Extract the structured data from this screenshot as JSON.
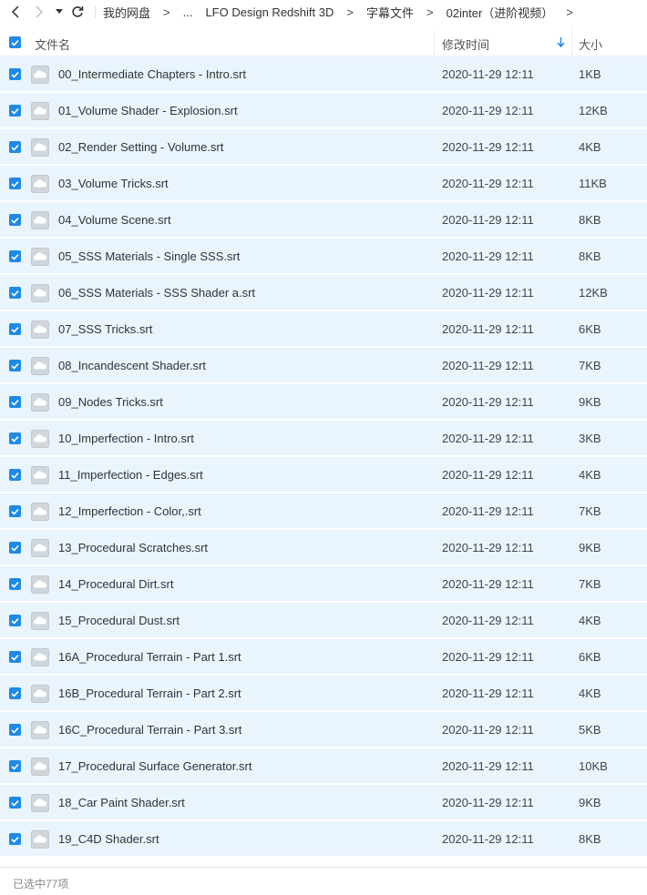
{
  "nav": {
    "breadcrumbs": [
      "我的网盘",
      "...",
      "LFO Design Redshift 3D",
      "字幕文件",
      "02inter（进阶视频）"
    ],
    "separator": ">"
  },
  "header": {
    "name": "文件名",
    "date": "修改时间",
    "size": "大小"
  },
  "files": [
    {
      "name": "00_Intermediate Chapters - Intro.srt",
      "date": "2020-11-29 12:11",
      "size": "1KB"
    },
    {
      "name": "01_Volume Shader - Explosion.srt",
      "date": "2020-11-29 12:11",
      "size": "12KB"
    },
    {
      "name": "02_Render Setting - Volume.srt",
      "date": "2020-11-29 12:11",
      "size": "4KB"
    },
    {
      "name": "03_Volume Tricks.srt",
      "date": "2020-11-29 12:11",
      "size": "11KB"
    },
    {
      "name": "04_Volume Scene.srt",
      "date": "2020-11-29 12:11",
      "size": "8KB"
    },
    {
      "name": "05_SSS Materials - Single SSS.srt",
      "date": "2020-11-29 12:11",
      "size": "8KB"
    },
    {
      "name": "06_SSS Materials - SSS Shader a.srt",
      "date": "2020-11-29 12:11",
      "size": "12KB"
    },
    {
      "name": "07_SSS Tricks.srt",
      "date": "2020-11-29 12:11",
      "size": "6KB"
    },
    {
      "name": "08_Incandescent Shader.srt",
      "date": "2020-11-29 12:11",
      "size": "7KB"
    },
    {
      "name": "09_Nodes Tricks.srt",
      "date": "2020-11-29 12:11",
      "size": "9KB"
    },
    {
      "name": "10_Imperfection - Intro.srt",
      "date": "2020-11-29 12:11",
      "size": "3KB"
    },
    {
      "name": "11_Imperfection - Edges.srt",
      "date": "2020-11-29 12:11",
      "size": "4KB"
    },
    {
      "name": "12_Imperfection - Color,.srt",
      "date": "2020-11-29 12:11",
      "size": "7KB"
    },
    {
      "name": "13_Procedural Scratches.srt",
      "date": "2020-11-29 12:11",
      "size": "9KB"
    },
    {
      "name": "14_Procedural Dirt.srt",
      "date": "2020-11-29 12:11",
      "size": "7KB"
    },
    {
      "name": "15_Procedural Dust.srt",
      "date": "2020-11-29 12:11",
      "size": "4KB"
    },
    {
      "name": "16A_Procedural Terrain - Part 1.srt",
      "date": "2020-11-29 12:11",
      "size": "6KB"
    },
    {
      "name": "16B_Procedural Terrain - Part 2.srt",
      "date": "2020-11-29 12:11",
      "size": "4KB"
    },
    {
      "name": "16C_Procedural Terrain - Part 3.srt",
      "date": "2020-11-29 12:11",
      "size": "5KB"
    },
    {
      "name": "17_Procedural Surface Generator.srt",
      "date": "2020-11-29 12:11",
      "size": "10KB"
    },
    {
      "name": "18_Car Paint Shader.srt",
      "date": "2020-11-29 12:11",
      "size": "9KB"
    },
    {
      "name": "19_C4D Shader.srt",
      "date": "2020-11-29 12:11",
      "size": "8KB"
    }
  ],
  "status": {
    "text": "已选中77项"
  },
  "colors": {
    "accent": "#1e8ae6",
    "row_selected": "#e9f4fd"
  },
  "icons": [
    "back-arrow-icon",
    "forward-arrow-icon",
    "dropdown-caret-icon",
    "refresh-icon",
    "checkbox-checked-icon",
    "sort-down-icon",
    "cloud-file-icon"
  ]
}
